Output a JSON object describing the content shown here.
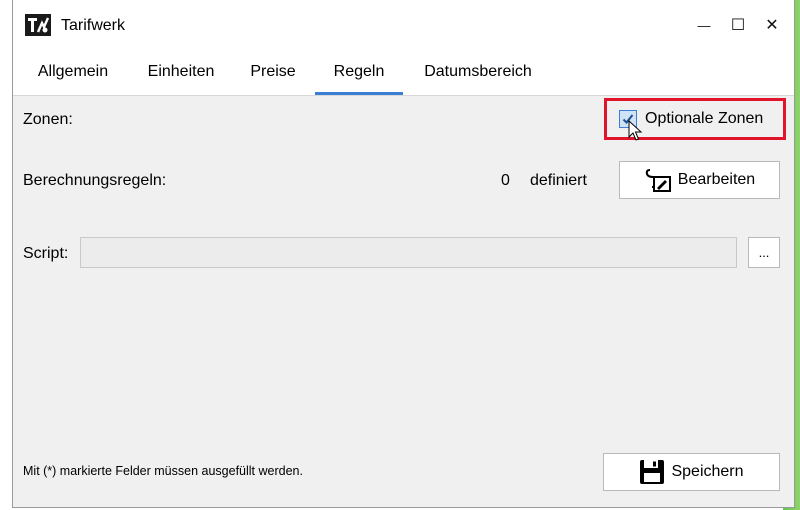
{
  "window": {
    "title": "Tarifwerk",
    "minimize_glyph": "—",
    "maximize_glyph": "☐",
    "close_glyph": "✕"
  },
  "tabs": [
    {
      "label": "Allgemein",
      "active": false
    },
    {
      "label": "Einheiten",
      "active": false
    },
    {
      "label": "Preise",
      "active": false
    },
    {
      "label": "Regeln",
      "active": true
    },
    {
      "label": "Datumsbereich",
      "active": false
    }
  ],
  "zones": {
    "label": "Zonen:",
    "checkbox_label": "Optionale Zonen",
    "checked": true
  },
  "rules": {
    "label": "Berechnungsregeln:",
    "count": "0",
    "count_suffix": "definiert",
    "edit_button": "Bearbeiten",
    "edit_icon": "edit-rules-icon"
  },
  "script": {
    "label": "Script:",
    "value": "",
    "browse_button": "..."
  },
  "footer": {
    "note": "Mit (*) markierte Felder müssen ausgefüllt werden.",
    "save_button": "Speichern",
    "save_icon": "save-icon"
  },
  "colors": {
    "accent": "#3b7ed6",
    "highlight": "#e0142a",
    "desktop_green": "#6ccb5f"
  }
}
